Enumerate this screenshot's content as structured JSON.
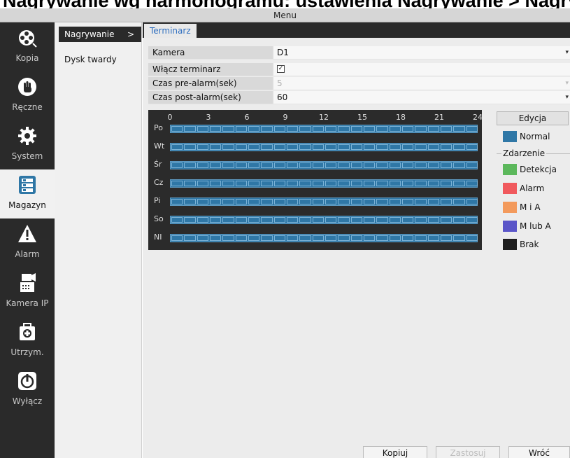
{
  "caption": "Nagrywanie wg harmonogramu: ustawienia Nagrywanie > Nagrywanie wg harmonogramu",
  "window": {
    "title": "Menu"
  },
  "nav": {
    "items": [
      {
        "label": "Kopia",
        "icon": "film-reel-icon"
      },
      {
        "label": "Ręczne",
        "icon": "hand-icon"
      },
      {
        "label": "System",
        "icon": "gear-icon"
      },
      {
        "label": "Magazyn",
        "icon": "storage-icon",
        "active": true
      },
      {
        "label": "Alarm",
        "icon": "warning-icon"
      },
      {
        "label": "Kamera IP",
        "icon": "ip-camera-icon"
      },
      {
        "label": "Utrzym.",
        "icon": "maintenance-icon"
      },
      {
        "label": "Wyłącz",
        "icon": "power-icon"
      }
    ]
  },
  "sub": {
    "items": [
      {
        "label": "Nagrywanie",
        "active": true,
        "chevron": ">"
      },
      {
        "label": "Dysk twardy"
      }
    ]
  },
  "tab": {
    "label": "Terminarz"
  },
  "form": {
    "rows": [
      {
        "label": "Kamera",
        "value": "D1",
        "dropdown": true
      },
      {
        "label": "Włącz terminarz",
        "value": "✓",
        "checkbox": true,
        "checked": true
      },
      {
        "label": "Czas pre-alarm(sek)",
        "value": "5",
        "dropdown": true,
        "disabled": true
      },
      {
        "label": "Czas post-alarm(sek)",
        "value": "60",
        "dropdown": true
      }
    ]
  },
  "schedule": {
    "hours": [
      "0",
      "3",
      "6",
      "9",
      "12",
      "15",
      "18",
      "21",
      "24"
    ],
    "days": [
      "Po",
      "Wt",
      "Śr",
      "Cz",
      "Pi",
      "So",
      "NI"
    ],
    "mode": "Normal"
  },
  "legend": {
    "edit_label": "Edycja",
    "normal": {
      "label": "Normal",
      "color": "#2f77a6"
    },
    "event_group_label": "Zdarzenie",
    "events": [
      {
        "label": "Detekcja",
        "color": "#5cb85c"
      },
      {
        "label": "Alarm",
        "color": "#f0595d"
      },
      {
        "label": "M i A",
        "color": "#f39a5c"
      },
      {
        "label": "M lub A",
        "color": "#5a55c8"
      }
    ],
    "none": {
      "label": "Brak",
      "color": "#1e1e1e"
    }
  },
  "buttons": {
    "copy": "Kopiuj",
    "apply": "Zastosuj",
    "back": "Wróć"
  }
}
